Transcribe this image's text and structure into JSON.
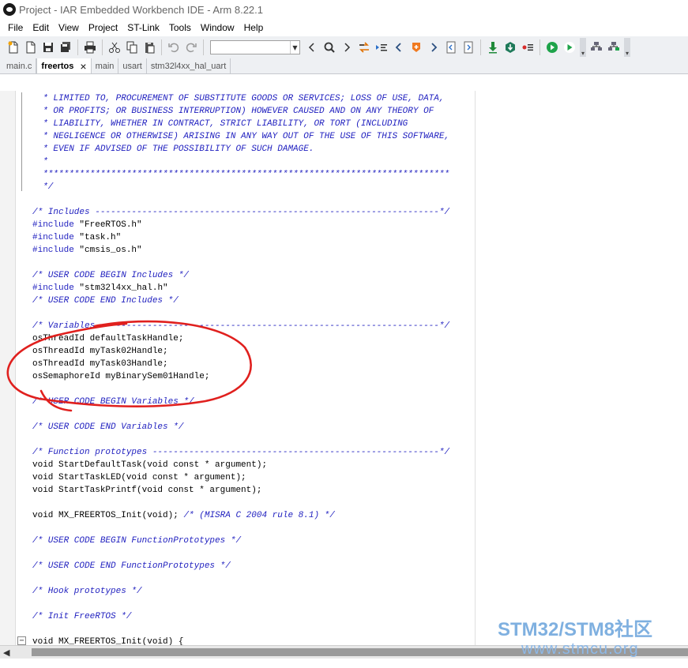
{
  "window": {
    "title": "Project - IAR Embedded Workbench IDE - Arm 8.22.1"
  },
  "menu": [
    "File",
    "Edit",
    "View",
    "Project",
    "ST-Link",
    "Tools",
    "Window",
    "Help"
  ],
  "toolbar": {
    "groups": [
      [
        "new-file-icon",
        "open-icon",
        "save-icon",
        "save-all-icon"
      ],
      [
        "print-icon"
      ],
      [
        "cut-icon",
        "copy-icon",
        "paste-icon"
      ],
      [
        "undo-icon",
        "redo-icon"
      ]
    ],
    "search_value": "",
    "nav_icons": [
      "back-icon",
      "find-icon",
      "forward-icon",
      "toggle-bookmark-icon",
      "bookmark-list-icon",
      "previous-icon",
      "breakpoint-icon",
      "next-icon",
      "go-to-icon",
      "window-icon"
    ],
    "build_icons": [
      "download-icon",
      "debug-icon",
      "options-icon",
      "go-icon",
      "run-icon"
    ],
    "extra_icons": [
      "stack-icon",
      "build-batch-icon"
    ]
  },
  "tabs": [
    {
      "label": "main.c",
      "active": false
    },
    {
      "label": "freertos",
      "active": true,
      "close": "×"
    },
    {
      "label": "main",
      "active": false
    },
    {
      "label": "usart",
      "active": false
    },
    {
      "label": "stm32l4xx_hal_uart",
      "active": false
    }
  ],
  "code_lines": [
    [
      {
        "t": "  * LIMITED TO, PROCUREMENT OF SUBSTITUTE GOODS OR SERVICES; LOSS OF USE, DATA,",
        "c": "cmt"
      }
    ],
    [
      {
        "t": "  * OR PROFITS; OR BUSINESS INTERRUPTION) HOWEVER CAUSED AND ON ANY THEORY OF",
        "c": "cmt"
      }
    ],
    [
      {
        "t": "  * LIABILITY, WHETHER IN CONTRACT, STRICT LIABILITY, OR TORT (INCLUDING",
        "c": "cmt"
      }
    ],
    [
      {
        "t": "  * NEGLIGENCE OR OTHERWISE) ARISING IN ANY WAY OUT OF THE USE OF THIS SOFTWARE,",
        "c": "cmt"
      }
    ],
    [
      {
        "t": "  * EVEN IF ADVISED OF THE POSSIBILITY OF SUCH DAMAGE.",
        "c": "cmt"
      }
    ],
    [
      {
        "t": "  *",
        "c": "cmt"
      }
    ],
    [
      {
        "t": "  ******************************************************************************",
        "c": "cmt"
      }
    ],
    [
      {
        "t": "  */",
        "c": "cmt"
      }
    ],
    [
      {
        "t": "",
        "c": "plain"
      }
    ],
    [
      {
        "t": "/* Includes ------------------------------------------------------------------*/",
        "c": "cmt"
      }
    ],
    [
      {
        "t": "#include ",
        "c": "pp"
      },
      {
        "t": "\"FreeRTOS.h\"",
        "c": "str"
      }
    ],
    [
      {
        "t": "#include ",
        "c": "pp"
      },
      {
        "t": "\"task.h\"",
        "c": "str"
      }
    ],
    [
      {
        "t": "#include ",
        "c": "pp"
      },
      {
        "t": "\"cmsis_os.h\"",
        "c": "str"
      }
    ],
    [
      {
        "t": "",
        "c": "plain"
      }
    ],
    [
      {
        "t": "/* USER CODE BEGIN Includes */",
        "c": "cmt"
      }
    ],
    [
      {
        "t": "#include ",
        "c": "pp"
      },
      {
        "t": "\"stm32l4xx_hal.h\"",
        "c": "str"
      }
    ],
    [
      {
        "t": "/* USER CODE END Includes */",
        "c": "cmt"
      }
    ],
    [
      {
        "t": "",
        "c": "plain"
      }
    ],
    [
      {
        "t": "/* Variables -----------------------------------------------------------------*/",
        "c": "cmt"
      }
    ],
    [
      {
        "t": "osThreadId defaultTaskHandle;",
        "c": "plain"
      }
    ],
    [
      {
        "t": "osThreadId myTask02Handle;",
        "c": "plain"
      }
    ],
    [
      {
        "t": "osThreadId myTask03Handle;",
        "c": "plain"
      }
    ],
    [
      {
        "t": "osSemaphoreId myBinarySem01Handle;",
        "c": "plain"
      }
    ],
    [
      {
        "t": "",
        "c": "plain"
      }
    ],
    [
      {
        "t": "/* USER CODE BEGIN Variables */",
        "c": "cmt"
      }
    ],
    [
      {
        "t": "",
        "c": "plain"
      }
    ],
    [
      {
        "t": "/* USER CODE END Variables */",
        "c": "cmt"
      }
    ],
    [
      {
        "t": "",
        "c": "plain"
      }
    ],
    [
      {
        "t": "/* Function prototypes -------------------------------------------------------*/",
        "c": "cmt"
      }
    ],
    [
      {
        "t": "void StartDefaultTask(void const * argument);",
        "c": "plain"
      }
    ],
    [
      {
        "t": "void StartTaskLED(void const * argument);",
        "c": "plain"
      }
    ],
    [
      {
        "t": "void StartTaskPrintf(void const * argument);",
        "c": "plain"
      }
    ],
    [
      {
        "t": "",
        "c": "plain"
      }
    ],
    [
      {
        "t": "void MX_FREERTOS_Init(void); ",
        "c": "plain"
      },
      {
        "t": "/* (MISRA C 2004 rule 8.1) */",
        "c": "cmt"
      }
    ],
    [
      {
        "t": "",
        "c": "plain"
      }
    ],
    [
      {
        "t": "/* USER CODE BEGIN FunctionPrototypes */",
        "c": "cmt"
      }
    ],
    [
      {
        "t": "",
        "c": "plain"
      }
    ],
    [
      {
        "t": "/* USER CODE END FunctionPrototypes */",
        "c": "cmt"
      }
    ],
    [
      {
        "t": "",
        "c": "plain"
      }
    ],
    [
      {
        "t": "/* Hook prototypes */",
        "c": "cmt"
      }
    ],
    [
      {
        "t": "",
        "c": "plain"
      }
    ],
    [
      {
        "t": "/* Init FreeRTOS */",
        "c": "cmt"
      }
    ],
    [
      {
        "t": "",
        "c": "plain"
      }
    ],
    [
      {
        "t": "void MX_FREERTOS_Init(void) {",
        "c": "plain"
      }
    ]
  ],
  "fold_marker": "−",
  "watermark": {
    "top": "STM32/STM8社区",
    "bottom": "www.stmcu.org"
  },
  "colors": {
    "comment": "#1f1fbf",
    "annotation": "#e0201e",
    "watermark": "#7fb0e0"
  }
}
